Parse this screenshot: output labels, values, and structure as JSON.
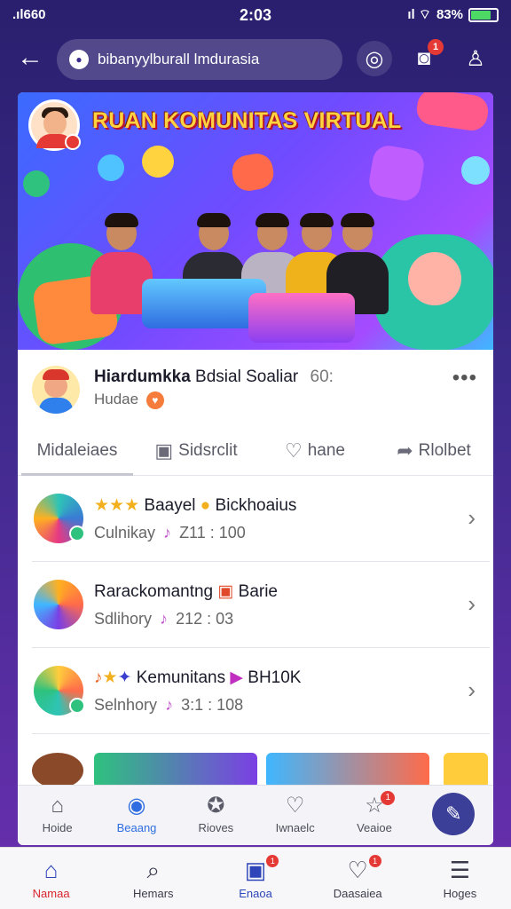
{
  "status_bar": {
    "signal": ".ıl660",
    "time": "2:03",
    "battery_percent": "83%"
  },
  "top_bar": {
    "search_value": "bibanyylburall lmdurasia",
    "icons": [
      "back-arrow-icon",
      "compass-icon",
      "camera-icon",
      "profile-icon"
    ],
    "camera_badge": "1"
  },
  "banner": {
    "title": "RUAN KOMUNITAS VIRTUAL"
  },
  "post": {
    "name_bold": "Hiardumkka",
    "name_rest": " Bdsial Soaliar",
    "count": "60:",
    "subtitle": "Hudae",
    "more": "•••"
  },
  "actions": [
    {
      "label": "Midaleiaes",
      "icon": "M"
    },
    {
      "label": "Sidsrclit",
      "icon": "▣"
    },
    {
      "label": "hane",
      "icon": "♡"
    },
    {
      "label": "Rlolbet",
      "icon": "➦"
    }
  ],
  "list_items": [
    {
      "title": "Baayel",
      "title2": "Bickhoaius",
      "meta": "Culnikay",
      "time": "Z11 : 100",
      "colors": [
        "#2ec4b6",
        "#e63984"
      ]
    },
    {
      "title": "Rarackomantng",
      "title2": "Barie",
      "meta": "Sdlihory",
      "time": "212 : 03",
      "colors": [
        "#ffb020",
        "#7b3fe4"
      ]
    },
    {
      "title": "Kemunitans",
      "title2": "BH10K",
      "meta": "Selnhory",
      "time": "3:1 : 108",
      "colors": [
        "#ffcd3c",
        "#2ec27e"
      ]
    }
  ],
  "inner_nav": [
    {
      "label": "Hoide",
      "icon": "⌂"
    },
    {
      "label": "Beaang",
      "icon": "◉"
    },
    {
      "label": "Rioves",
      "icon": "✪"
    },
    {
      "label": "Iwnaelc",
      "icon": "♡"
    },
    {
      "label": "Veaioe",
      "icon": "☆",
      "badge": "1"
    }
  ],
  "bottom_nav": [
    {
      "label": "Namaa",
      "icon": "⌂"
    },
    {
      "label": "Hemars",
      "icon": "⌕"
    },
    {
      "label": "Enaoa",
      "icon": "▣",
      "badge": "1"
    },
    {
      "label": "Daasaiea",
      "icon": "♡",
      "badge": "1"
    },
    {
      "label": "Hoges",
      "icon": "☰"
    }
  ],
  "colors": {
    "background": "#3b2a8a",
    "accent_blue": "#2d45b8",
    "accent_red": "#d8262e",
    "banner_title": "#ffd23f"
  }
}
